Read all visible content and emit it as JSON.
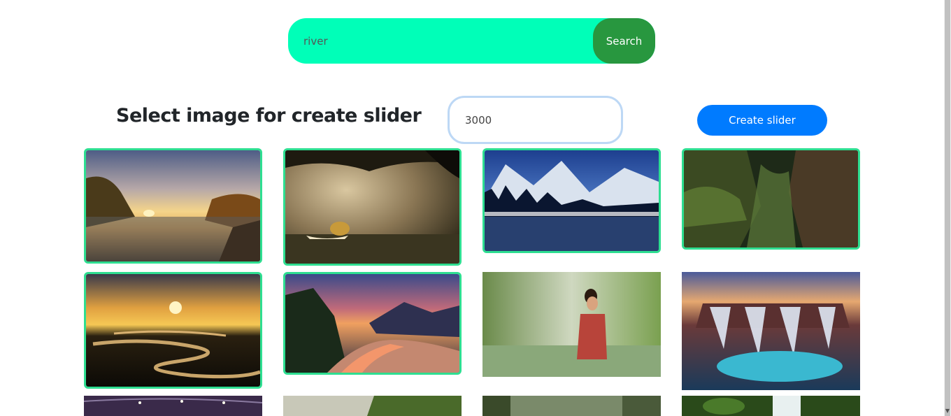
{
  "search": {
    "value": "river",
    "button_label": "Search"
  },
  "slider": {
    "title": "Select image for create slider",
    "duration_value": "3000",
    "create_button_label": "Create slider"
  },
  "images": [
    {
      "id": "sunset-river-autumn",
      "selected": true
    },
    {
      "id": "misty-boat-river",
      "selected": true
    },
    {
      "id": "snowy-mountain-lake",
      "selected": true
    },
    {
      "id": "green-canyon",
      "selected": true
    },
    {
      "id": "winding-river-sunset",
      "selected": true
    },
    {
      "id": "mountain-river-dusk",
      "selected": true
    },
    {
      "id": "woman-in-river",
      "selected": false
    },
    {
      "id": "waterfall",
      "selected": false
    },
    {
      "id": "bridge-night",
      "selected": false
    },
    {
      "id": "forest-clearing",
      "selected": false
    },
    {
      "id": "misty-forest",
      "selected": false
    },
    {
      "id": "mossy-stream",
      "selected": false
    }
  ],
  "colors": {
    "search_bar": "#00ffb8",
    "search_button": "#28973f",
    "create_button": "#007bff",
    "selected_border": "#2ede91"
  }
}
